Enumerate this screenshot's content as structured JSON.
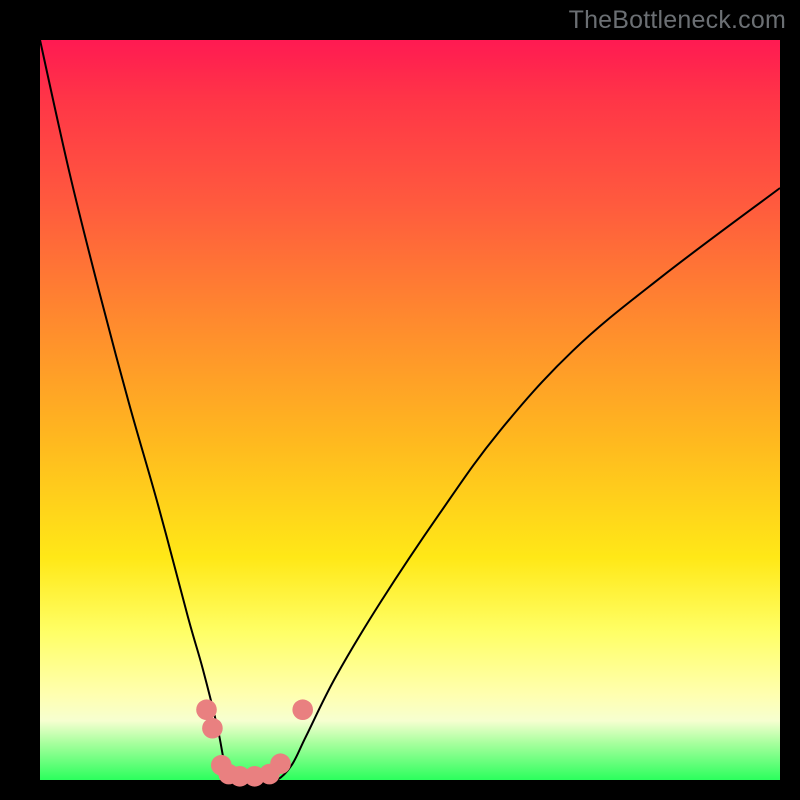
{
  "watermark": "TheBottleneck.com",
  "colors": {
    "gradient_top": "#ff1a52",
    "gradient_mid": "#ffe817",
    "gradient_bottom": "#2bff5d",
    "curve": "#000000",
    "marker": "#e98080",
    "frame": "#000000"
  },
  "chart_data": {
    "type": "line",
    "title": "",
    "xlabel": "",
    "ylabel": "",
    "xlim": [
      0,
      100
    ],
    "ylim": [
      0,
      100
    ],
    "grid": false,
    "note": "Approximate V-shaped bottleneck curve. Axes have no visible tick labels; values are read as percentages of plot extent. Curve descends steeply from top-left to a flat bottom near x≈25–32 at y≈0, then rises smoothly toward upper right reaching ~y≈80 at x=100.",
    "series": [
      {
        "name": "bottleneck-curve",
        "x": [
          0,
          4,
          8,
          12,
          16,
          20,
          22,
          24,
          25,
          26,
          28,
          30,
          32,
          34,
          36,
          40,
          46,
          54,
          62,
          72,
          84,
          100
        ],
        "y": [
          100,
          82,
          66,
          51,
          37,
          22,
          15,
          7,
          2,
          0,
          0,
          0,
          0,
          2,
          6,
          14,
          24,
          36,
          47,
          58,
          68,
          80
        ]
      }
    ],
    "markers": [
      {
        "x": 22.5,
        "y": 9.5,
        "r": 1.3
      },
      {
        "x": 23.3,
        "y": 7.0,
        "r": 1.3
      },
      {
        "x": 24.5,
        "y": 2.0,
        "r": 1.3
      },
      {
        "x": 25.5,
        "y": 0.8,
        "r": 1.3
      },
      {
        "x": 27.0,
        "y": 0.5,
        "r": 1.3
      },
      {
        "x": 29.0,
        "y": 0.5,
        "r": 1.3
      },
      {
        "x": 31.0,
        "y": 0.8,
        "r": 1.3
      },
      {
        "x": 32.5,
        "y": 2.2,
        "r": 1.3
      },
      {
        "x": 35.5,
        "y": 9.5,
        "r": 1.3
      }
    ]
  }
}
